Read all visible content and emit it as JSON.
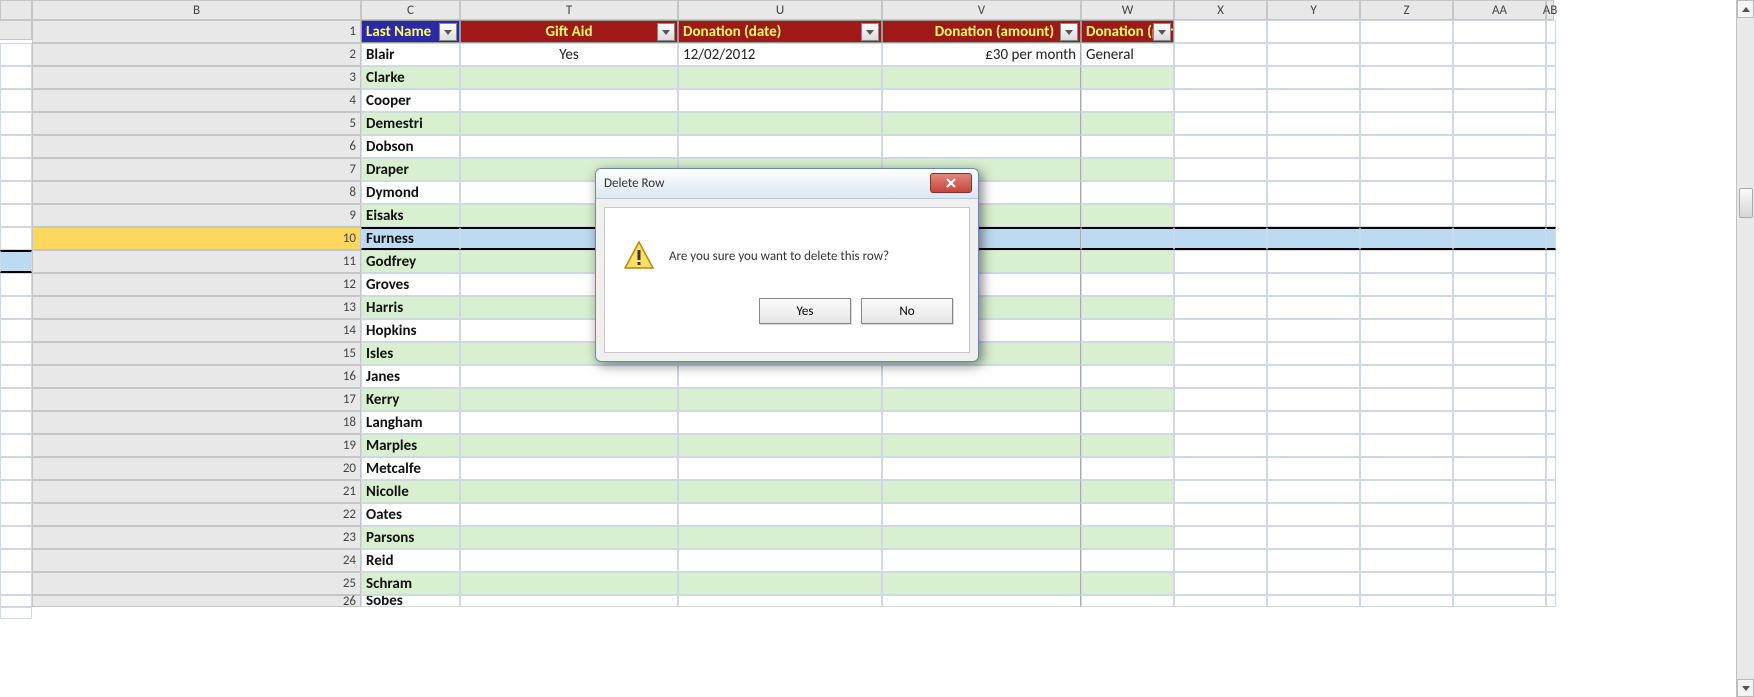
{
  "columns": {
    "B": "B",
    "C": "C",
    "T": "T",
    "U": "U",
    "V": "V",
    "W": "W",
    "X": "X",
    "Y": "Y",
    "Z": "Z",
    "AA": "AA",
    "AB": "AB"
  },
  "headers": {
    "last_name": "Last Name",
    "gift_aid": "Gift Aid",
    "donation_date": "Donation (date)",
    "donation_amount": "Donation (amount)",
    "donation_purpose": "Donation (purpose)"
  },
  "rows": [
    {
      "n": 1
    },
    {
      "n": 2,
      "last": "Blair",
      "gift": "Yes",
      "date": "12/02/2012",
      "amount": "£30 per month",
      "purpose": "General"
    },
    {
      "n": 3,
      "last": "Clarke"
    },
    {
      "n": 4,
      "last": "Cooper"
    },
    {
      "n": 5,
      "last": "Demestri"
    },
    {
      "n": 6,
      "last": "Dobson"
    },
    {
      "n": 7,
      "last": "Draper"
    },
    {
      "n": 8,
      "last": "Dymond"
    },
    {
      "n": 9,
      "last": "Eisaks"
    },
    {
      "n": 10,
      "last": "Furness"
    },
    {
      "n": 11,
      "last": "Godfrey"
    },
    {
      "n": 12,
      "last": "Groves"
    },
    {
      "n": 13,
      "last": "Harris"
    },
    {
      "n": 14,
      "last": "Hopkins"
    },
    {
      "n": 15,
      "last": "Isles"
    },
    {
      "n": 16,
      "last": "Janes"
    },
    {
      "n": 17,
      "last": "Kerry"
    },
    {
      "n": 18,
      "last": "Langham"
    },
    {
      "n": 19,
      "last": "Marples"
    },
    {
      "n": 20,
      "last": "Metcalfe"
    },
    {
      "n": 21,
      "last": "Nicolle"
    },
    {
      "n": 22,
      "last": "Oates"
    },
    {
      "n": 23,
      "last": "Parsons"
    },
    {
      "n": 24,
      "last": "Reid"
    },
    {
      "n": 25,
      "last": "Schram"
    },
    {
      "n": 26,
      "last": "Sobes"
    }
  ],
  "selected_row": 10,
  "dialog": {
    "title": "Delete Row",
    "message": "Are you sure you want to delete this row?",
    "yes": "Yes",
    "no": "No"
  }
}
